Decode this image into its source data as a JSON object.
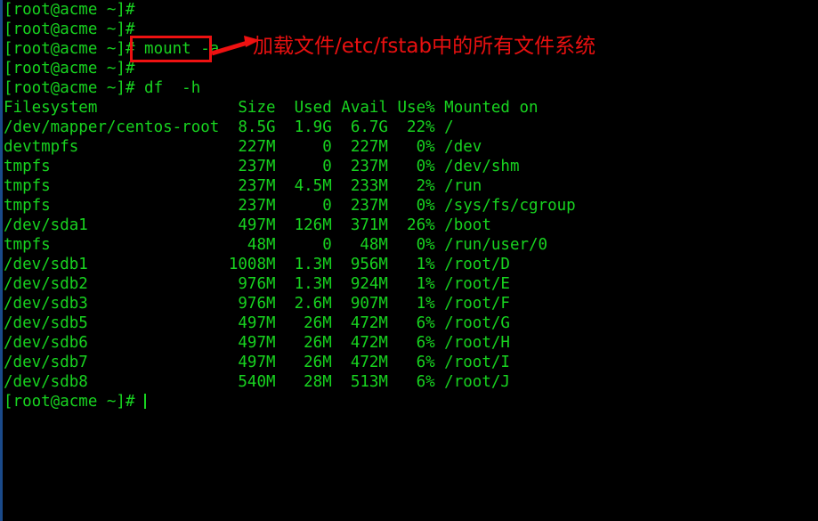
{
  "terminal": {
    "prompt": "[root@acme ~]#",
    "foreground_color": "#18d320",
    "background_color": "#000000",
    "edge_color": "#1a4a8a",
    "lines": [
      "[root@acme ~]# ",
      "[root@acme ~]# ",
      "[root@acme ~]# mount -a",
      "[root@acme ~]# ",
      "[root@acme ~]# df  -h",
      "Filesystem               Size  Used Avail Use% Mounted on",
      "/dev/mapper/centos-root  8.5G  1.9G  6.7G  22% /",
      "devtmpfs                 227M     0  227M   0% /dev",
      "tmpfs                    237M     0  237M   0% /dev/shm",
      "tmpfs                    237M  4.5M  233M   2% /run",
      "tmpfs                    237M     0  237M   0% /sys/fs/cgroup",
      "/dev/sda1                497M  126M  371M  26% /boot",
      "tmpfs                     48M     0   48M   0% /run/user/0",
      "/dev/sdb1               1008M  1.3M  956M   1% /root/D",
      "/dev/sdb2                976M  1.3M  924M   1% /root/E",
      "/dev/sdb3                976M  2.6M  907M   1% /root/F",
      "/dev/sdb5                497M   26M  472M   6% /root/G",
      "/dev/sdb6                497M   26M  472M   6% /root/H",
      "/dev/sdb7                497M   26M  472M   6% /root/I",
      "/dev/sdb8                540M   28M  513M   6% /root/J"
    ],
    "final_prompt": "[root@acme ~]# ",
    "command_entered": "mount -a",
    "df_command": "df  -h"
  },
  "df_table": {
    "headers": [
      "Filesystem",
      "Size",
      "Used",
      "Avail",
      "Use%",
      "Mounted on"
    ],
    "rows": [
      [
        "/dev/mapper/centos-root",
        "8.5G",
        "1.9G",
        "6.7G",
        "22%",
        "/"
      ],
      [
        "devtmpfs",
        "227M",
        "0",
        "227M",
        "0%",
        "/dev"
      ],
      [
        "tmpfs",
        "237M",
        "0",
        "237M",
        "0%",
        "/dev/shm"
      ],
      [
        "tmpfs",
        "237M",
        "4.5M",
        "233M",
        "2%",
        "/run"
      ],
      [
        "tmpfs",
        "237M",
        "0",
        "237M",
        "0%",
        "/sys/fs/cgroup"
      ],
      [
        "/dev/sda1",
        "497M",
        "126M",
        "371M",
        "26%",
        "/boot"
      ],
      [
        "tmpfs",
        "48M",
        "0",
        "48M",
        "0%",
        "/run/user/0"
      ],
      [
        "/dev/sdb1",
        "1008M",
        "1.3M",
        "956M",
        "1%",
        "/root/D"
      ],
      [
        "/dev/sdb2",
        "976M",
        "1.3M",
        "924M",
        "1%",
        "/root/E"
      ],
      [
        "/dev/sdb3",
        "976M",
        "2.6M",
        "907M",
        "1%",
        "/root/F"
      ],
      [
        "/dev/sdb5",
        "497M",
        "26M",
        "472M",
        "6%",
        "/root/G"
      ],
      [
        "/dev/sdb6",
        "497M",
        "26M",
        "472M",
        "6%",
        "/root/H"
      ],
      [
        "/dev/sdb7",
        "497M",
        "26M",
        "472M",
        "6%",
        "/root/I"
      ],
      [
        "/dev/sdb8",
        "540M",
        "28M",
        "513M",
        "6%",
        "/root/J"
      ]
    ]
  },
  "annotation": {
    "highlighted_command": "mount -a",
    "note_text": "加载文件/etc/fstab中的所有文件系统",
    "color": "#e81010"
  }
}
